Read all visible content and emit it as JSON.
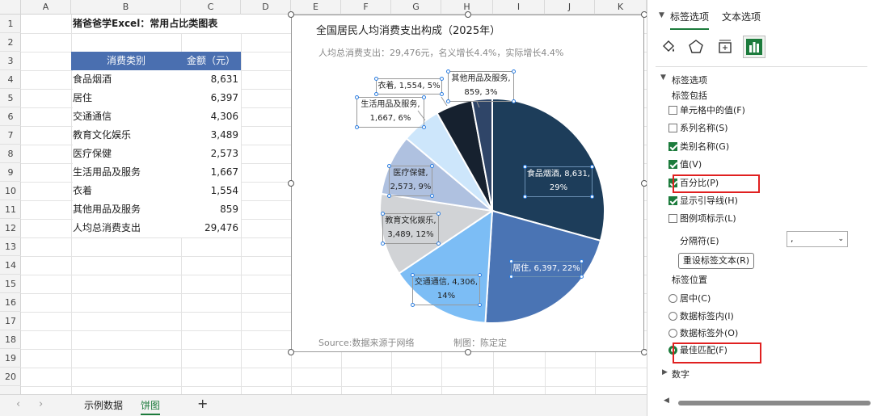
{
  "columns": [
    "A",
    "B",
    "C",
    "D",
    "E",
    "F",
    "G",
    "H",
    "I",
    "J",
    "K"
  ],
  "rows": [
    "1",
    "2",
    "3",
    "4",
    "5",
    "6",
    "7",
    "8",
    "9",
    "10",
    "11",
    "12",
    "13",
    "14",
    "15",
    "16",
    "17",
    "18",
    "19",
    "20"
  ],
  "sheet": {
    "title": "猪爸爸学Excel：常用占比类图表",
    "header": [
      "消费类别",
      "金额（元）"
    ],
    "rows": [
      [
        "食品烟酒",
        "8,631"
      ],
      [
        "居住",
        "6,397"
      ],
      [
        "交通通信",
        "4,306"
      ],
      [
        "教育文化娱乐",
        "3,489"
      ],
      [
        "医疗保健",
        "2,573"
      ],
      [
        "生活用品及服务",
        "1,667"
      ],
      [
        "衣着",
        "1,554"
      ],
      [
        "其他用品及服务",
        "859"
      ],
      [
        "人均总消费支出",
        "29,476"
      ]
    ]
  },
  "chart": {
    "title": "全国居民人均消费支出构成（2025年）",
    "subtitle": "人均总消费支出：29,476元，名义增长4.4%，实际增长4.4%",
    "source": "Source:数据来源于网络",
    "author": "制图：陈定定",
    "labels": [
      {
        "l1": "食品烟酒, 8,631,",
        "l2": "29%"
      },
      {
        "l1": "居住, 6,397, 22%",
        "l2": ""
      },
      {
        "l1": "交通通信, 4,306,",
        "l2": "14%"
      },
      {
        "l1": "教育文化娱乐,",
        "l2": "3,489, 12%"
      },
      {
        "l1": "医疗保健,",
        "l2": "2,573, 9%"
      },
      {
        "l1": "生活用品及服务,",
        "l2": "1,667, 6%"
      },
      {
        "l1": "衣着, 1,554, 5%",
        "l2": ""
      },
      {
        "l1": "其他用品及服务,",
        "l2": "859, 3%"
      }
    ]
  },
  "chart_data": {
    "type": "pie",
    "title": "全国居民人均消费支出构成（2025年）",
    "categories": [
      "食品烟酒",
      "居住",
      "交通通信",
      "教育文化娱乐",
      "医疗保健",
      "生活用品及服务",
      "衣着",
      "其他用品及服务"
    ],
    "values": [
      8631,
      6397,
      4306,
      3489,
      2573,
      1667,
      1554,
      859
    ],
    "percents": [
      29,
      22,
      14,
      12,
      9,
      6,
      5,
      3
    ],
    "colors": [
      "#1d3d5a",
      "#4a74b4",
      "#7cbdf5",
      "#d1d3d6",
      "#afc1e0",
      "#cde6fb",
      "#16212f",
      "#2f4568"
    ]
  },
  "sheet_tabs": {
    "tabs": [
      "示例数据",
      "饼图"
    ],
    "active": "饼图",
    "add": "+",
    "prev": "‹",
    "next": "›"
  },
  "panel": {
    "tabs": [
      "标签选项",
      "文本选项"
    ],
    "section": "标签选项",
    "include_title": "标签包括",
    "checks": [
      {
        "label": "单元格中的值(F)",
        "on": false
      },
      {
        "label": "系列名称(S)",
        "on": false
      },
      {
        "label": "类别名称(G)",
        "on": true
      },
      {
        "label": "值(V)",
        "on": true
      },
      {
        "label": "百分比(P)",
        "on": true
      },
      {
        "label": "显示引导线(H)",
        "on": true
      },
      {
        "label": "图例项标示(L)",
        "on": false
      }
    ],
    "separator_label": "分隔符(E)",
    "separator_value": ",",
    "reset_button": "重设标签文本(R)",
    "position_title": "标签位置",
    "radios": [
      {
        "label": "居中(C)",
        "on": false
      },
      {
        "label": "数据标签内(I)",
        "on": false
      },
      {
        "label": "数据标签外(O)",
        "on": false
      },
      {
        "label": "最佳匹配(F)",
        "on": true
      }
    ],
    "number_section": "数字"
  }
}
